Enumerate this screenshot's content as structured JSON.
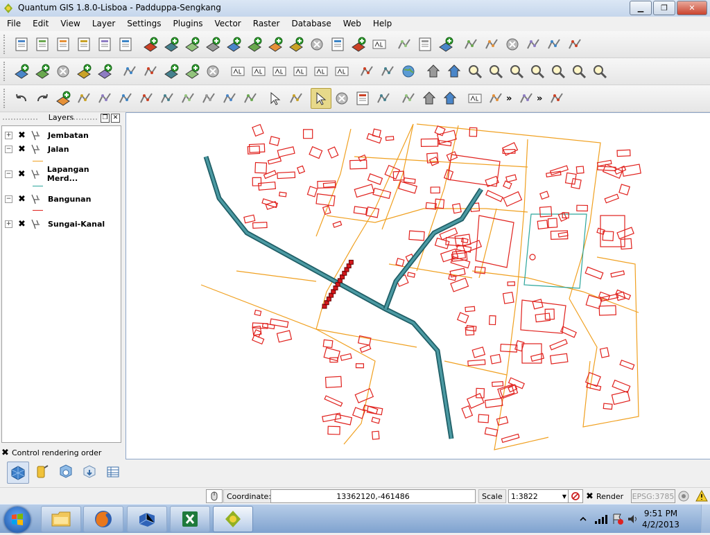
{
  "window": {
    "title": "Quantum GIS 1.8.0-Lisboa - Padduppa-Sengkang",
    "minimize": "▁",
    "maximize": "❐",
    "close": "✕"
  },
  "menu": [
    "File",
    "Edit",
    "View",
    "Layer",
    "Settings",
    "Plugins",
    "Vector",
    "Raster",
    "Database",
    "Web",
    "Help"
  ],
  "toolbars": {
    "row1": [
      "new-project",
      "open-project",
      "save-project",
      "save-as",
      "new-print-composer",
      "print-composer-manager",
      "add-vector-layer",
      "add-raster-layer",
      "add-postgis-layer",
      "add-spatialite-layer",
      "add-mssql-layer",
      "add-wms-layer",
      "add-wcs-layer",
      "add-wfs-layer",
      "remove-layer",
      "new-shapefile-layer",
      "add-oracle-layer",
      "add-delimited-text",
      "toggle-editing",
      "save-edits",
      "add-feature",
      "move-feature",
      "node-tool",
      "delete-selected",
      "cut-features",
      "copy-features",
      "paste-features"
    ],
    "row2": [
      "add-vector-group",
      "add-favorite",
      "remove-vector",
      "layer-properties",
      "layer-style",
      "digitize",
      "simplify",
      "add-ring",
      "add-part",
      "delete-ring",
      "label-abc",
      "pin-labels",
      "show-hide-labels",
      "move-label",
      "rotate-label",
      "change-label",
      "georeferencer",
      "histogram",
      "globe",
      "pan",
      "pan-to-selection",
      "zoom-in",
      "zoom-out",
      "zoom-native",
      "zoom-full",
      "zoom-layer",
      "zoom-selection",
      "zoom-last"
    ],
    "row3": [
      "undo",
      "redo",
      "add-ring-2",
      "simplify-feature",
      "reshape",
      "offset-curve",
      "split-feature",
      "merge-features",
      "merge-attributes",
      "rotate-point",
      "ring",
      "reshape-2",
      "identify",
      "processing-gear",
      "select-features",
      "deselect",
      "open-attribute-table",
      "measure",
      "annotation",
      "home",
      "home-2",
      "text-annotation",
      "d2s",
      "more",
      "plugin-check",
      "more",
      "screenshot-plugin"
    ],
    "more_label": "»"
  },
  "layers_panel": {
    "title": "Layers",
    "float_icon": "❐",
    "close_icon": "✕",
    "layers": [
      {
        "name": "Jembatan",
        "checked": "✖",
        "expander": "+",
        "legend_color": null
      },
      {
        "name": "Jalan",
        "checked": "✖",
        "expander": "−",
        "legend_color": "#f0a020"
      },
      {
        "name": "Lapangan Merd...",
        "checked": "✖",
        "expander": "−",
        "legend_color": "#2aa59b"
      },
      {
        "name": "Bangunan",
        "checked": "✖",
        "expander": "−",
        "legend_color": "#e0201c"
      },
      {
        "name": "Sungai-Kanal",
        "checked": "✖",
        "expander": "+",
        "legend_color": null
      }
    ],
    "control_rendering_order": {
      "label": "Control rendering order",
      "checked": "✖"
    }
  },
  "bottom_tools": [
    "map-overview",
    "gps-tool",
    "ogr-converter",
    "plugin-installer",
    "browser-panel"
  ],
  "status": {
    "coordinate_label": "Coordinate:",
    "coordinate_value": "13362120,-461486",
    "scale_label": "Scale",
    "scale_value": "1:3822",
    "render_label": "Render",
    "render_checked": "✖",
    "epsg": "EPSG:3785"
  },
  "taskbar": {
    "apps": [
      "file-explorer",
      "firefox",
      "windows-virtual-pc",
      "excel",
      "qgis"
    ],
    "time": "9:51 PM",
    "date": "4/2/2013"
  },
  "colors": {
    "roads": "#f0a020",
    "buildings": "#e0201c",
    "river": "#2d7a85",
    "field": "#2aa59b",
    "bridge": "#d4181c"
  }
}
